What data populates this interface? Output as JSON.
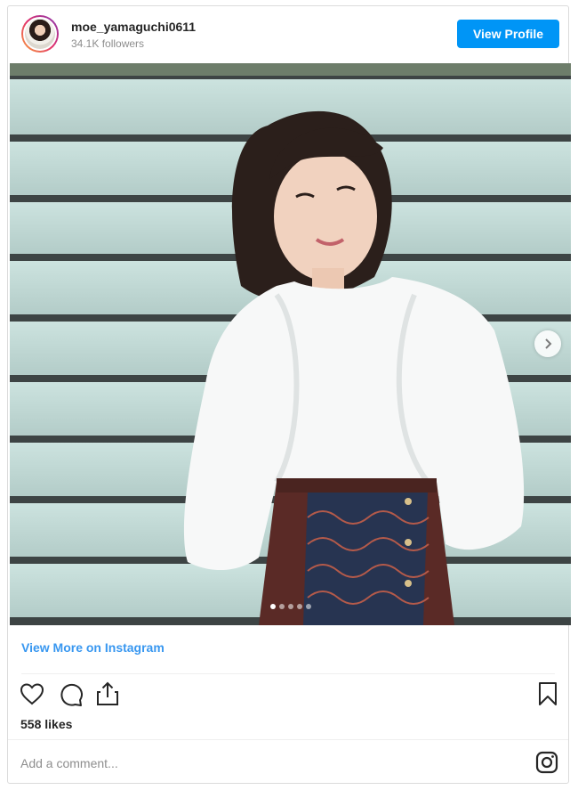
{
  "header": {
    "username": "moe_yamaguchi0611",
    "followers": "34.1K followers",
    "view_profile_label": "View Profile"
  },
  "carousel": {
    "total_slides": 5,
    "active_slide": 1
  },
  "links": {
    "view_more": "View More on Instagram"
  },
  "actions": {
    "icons": [
      "heart-icon",
      "comment-icon",
      "share-icon",
      "bookmark-icon"
    ]
  },
  "likes": "558 likes",
  "comment": {
    "placeholder": "Add a comment..."
  },
  "colors": {
    "primary_button": "#0095f6",
    "link": "#3897f0",
    "text": "#262626",
    "muted": "#8e8e8e"
  }
}
